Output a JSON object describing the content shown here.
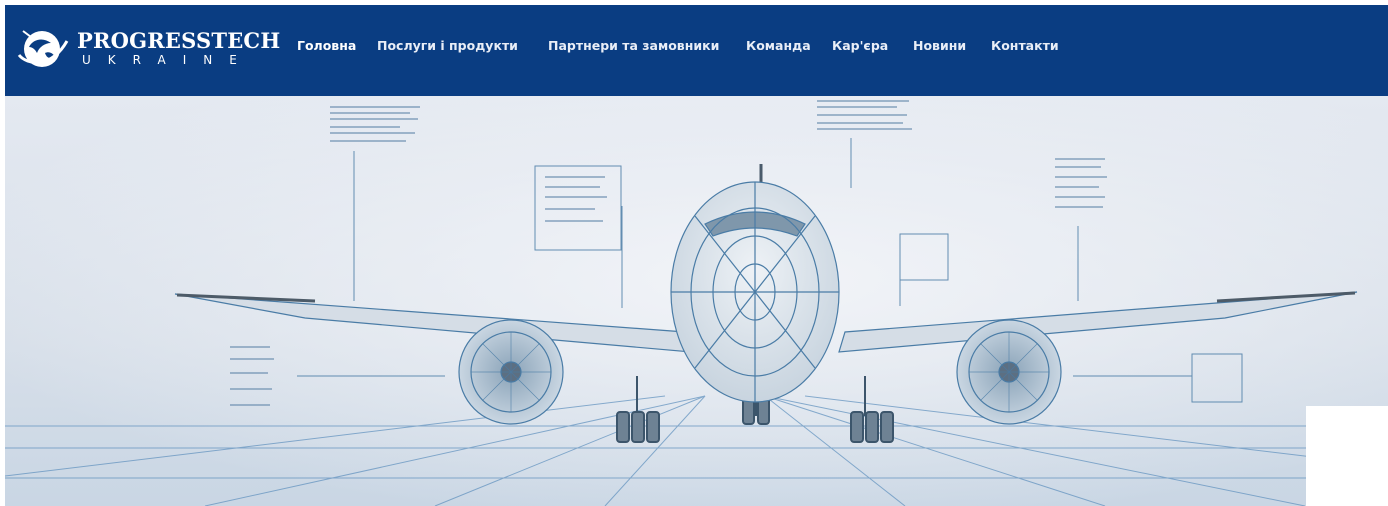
{
  "brand": {
    "name": "PROGRESSTECH",
    "subtitle": "UKRAINE",
    "logo_icon": "globe-swoosh-icon",
    "color": "#0a3d82"
  },
  "nav": {
    "items": [
      {
        "label": "Головна",
        "active": true
      },
      {
        "label": "Послуги і продукти",
        "active": false
      },
      {
        "label": "Партнери та замовники",
        "active": false
      },
      {
        "label": "Команда",
        "active": false
      },
      {
        "label": "Кар'єра",
        "active": false
      },
      {
        "label": "Новини",
        "active": false
      },
      {
        "label": "Контакти",
        "active": false
      }
    ]
  },
  "hero": {
    "image": "aircraft-blueprint-illustration",
    "palette": {
      "sky_top": "#dfe6f0",
      "sky_bottom": "#cfd9e6",
      "line": "#4a7ca6",
      "grid": "#5d8fbd"
    }
  }
}
